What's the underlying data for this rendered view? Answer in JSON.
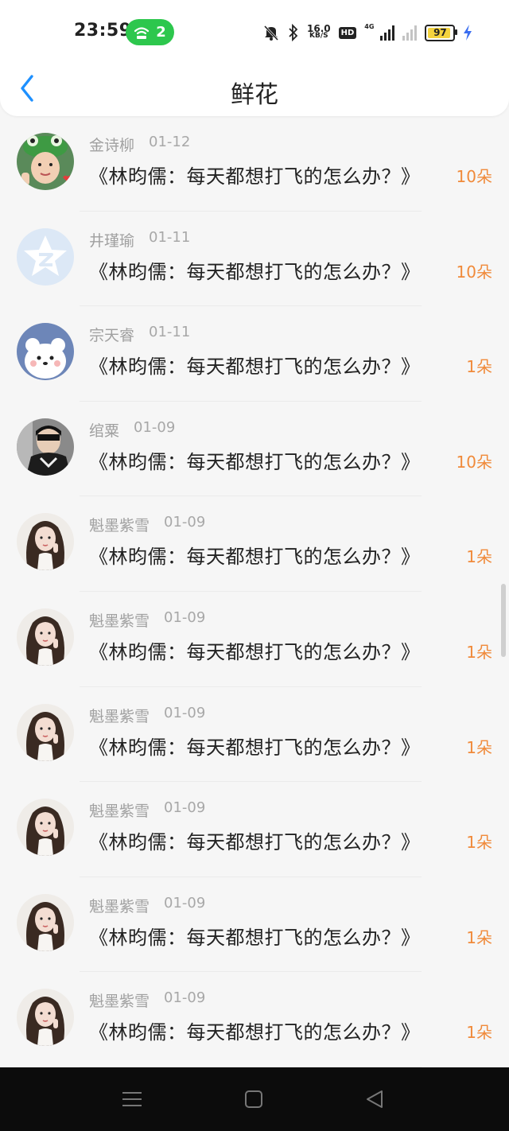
{
  "status_bar": {
    "time": "23:59",
    "hotspot_count": "2",
    "net_speed_value": "16.0",
    "net_speed_unit": "KB/S",
    "hd_label": "HD",
    "network_type": "4G",
    "battery_level": "97"
  },
  "header": {
    "title": "鲜花"
  },
  "colors": {
    "accent": "#1e90ff",
    "count": "#f08a3a",
    "hotspot": "#2dc74d"
  },
  "items": [
    {
      "name": "金诗柳",
      "date": "01-12",
      "work": "《林昀儒：每天都想打飞的怎么办？》",
      "count": "10朵",
      "avatar": "frog-hat-avatar"
    },
    {
      "name": "井瑾瑜",
      "date": "01-11",
      "work": "《林昀儒：每天都想打飞的怎么办？》",
      "count": "10朵",
      "avatar": "default-star-avatar"
    },
    {
      "name": "宗天睿",
      "date": "01-11",
      "work": "《林昀儒：每天都想打飞的怎么办？》",
      "count": "1朵",
      "avatar": "bear-avatar"
    },
    {
      "name": "绾粟",
      "date": "01-09",
      "work": "《林昀儒：每天都想打飞的怎么办？》",
      "count": "10朵",
      "avatar": "boy-avatar"
    },
    {
      "name": "魁墨紫雪",
      "date": "01-09",
      "work": "《林昀儒：每天都想打飞的怎么办？》",
      "count": "1朵",
      "avatar": "girl-avatar"
    },
    {
      "name": "魁墨紫雪",
      "date": "01-09",
      "work": "《林昀儒：每天都想打飞的怎么办？》",
      "count": "1朵",
      "avatar": "girl-avatar"
    },
    {
      "name": "魁墨紫雪",
      "date": "01-09",
      "work": "《林昀儒：每天都想打飞的怎么办？》",
      "count": "1朵",
      "avatar": "girl-avatar"
    },
    {
      "name": "魁墨紫雪",
      "date": "01-09",
      "work": "《林昀儒：每天都想打飞的怎么办？》",
      "count": "1朵",
      "avatar": "girl-avatar"
    },
    {
      "name": "魁墨紫雪",
      "date": "01-09",
      "work": "《林昀儒：每天都想打飞的怎么办？》",
      "count": "1朵",
      "avatar": "girl-avatar"
    },
    {
      "name": "魁墨紫雪",
      "date": "01-09",
      "work": "《林昀儒：每天都想打飞的怎么办？》",
      "count": "1朵",
      "avatar": "girl-avatar"
    }
  ],
  "nav": {
    "menu_icon": "menu-icon",
    "home_icon": "home-square-icon",
    "back_icon": "back-triangle-icon"
  }
}
